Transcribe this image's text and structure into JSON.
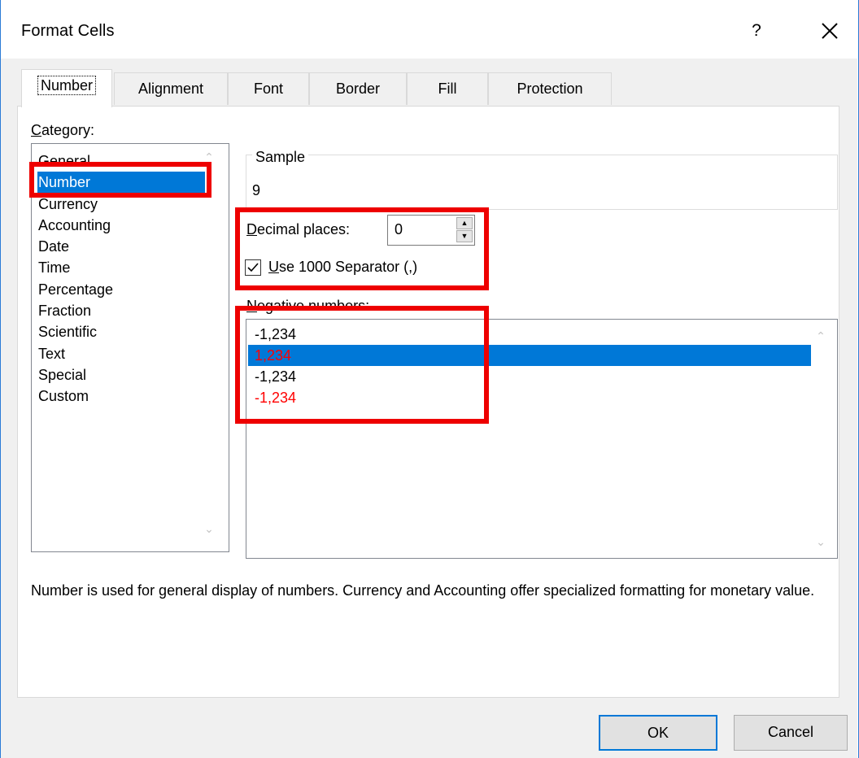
{
  "window": {
    "title": "Format Cells",
    "help_label": "?",
    "close_icon": "close-icon"
  },
  "tabs": [
    {
      "label": "Number",
      "active": true
    },
    {
      "label": "Alignment",
      "active": false
    },
    {
      "label": "Font",
      "active": false
    },
    {
      "label": "Border",
      "active": false
    },
    {
      "label": "Fill",
      "active": false
    },
    {
      "label": "Protection",
      "active": false
    }
  ],
  "category": {
    "label": "Category:",
    "items": [
      "General",
      "Number",
      "Currency",
      "Accounting",
      "Date",
      "Time",
      "Percentage",
      "Fraction",
      "Scientific",
      "Text",
      "Special",
      "Custom"
    ],
    "selected": "Number"
  },
  "sample": {
    "label": "Sample",
    "value": "9"
  },
  "decimal_places": {
    "label": "Decimal places:",
    "value": "0"
  },
  "separator": {
    "label": "Use 1000 Separator (,)",
    "checked": true
  },
  "negative_numbers": {
    "label": "Negative numbers:",
    "items": [
      {
        "text": "-1,234",
        "color": "#000000"
      },
      {
        "text": "1,234",
        "color": "#ff0000",
        "selected": true
      },
      {
        "text": "-1,234",
        "color": "#000000"
      },
      {
        "text": "-1,234",
        "color": "#ff0000"
      }
    ]
  },
  "description": "Number is used for general display of numbers.  Currency and Accounting offer specialized formatting for monetary value.",
  "buttons": {
    "ok": "OK",
    "cancel": "Cancel"
  },
  "colors": {
    "accent": "#0078d7",
    "highlight_annotation": "#ee0000",
    "negative_red": "#ff0000"
  }
}
